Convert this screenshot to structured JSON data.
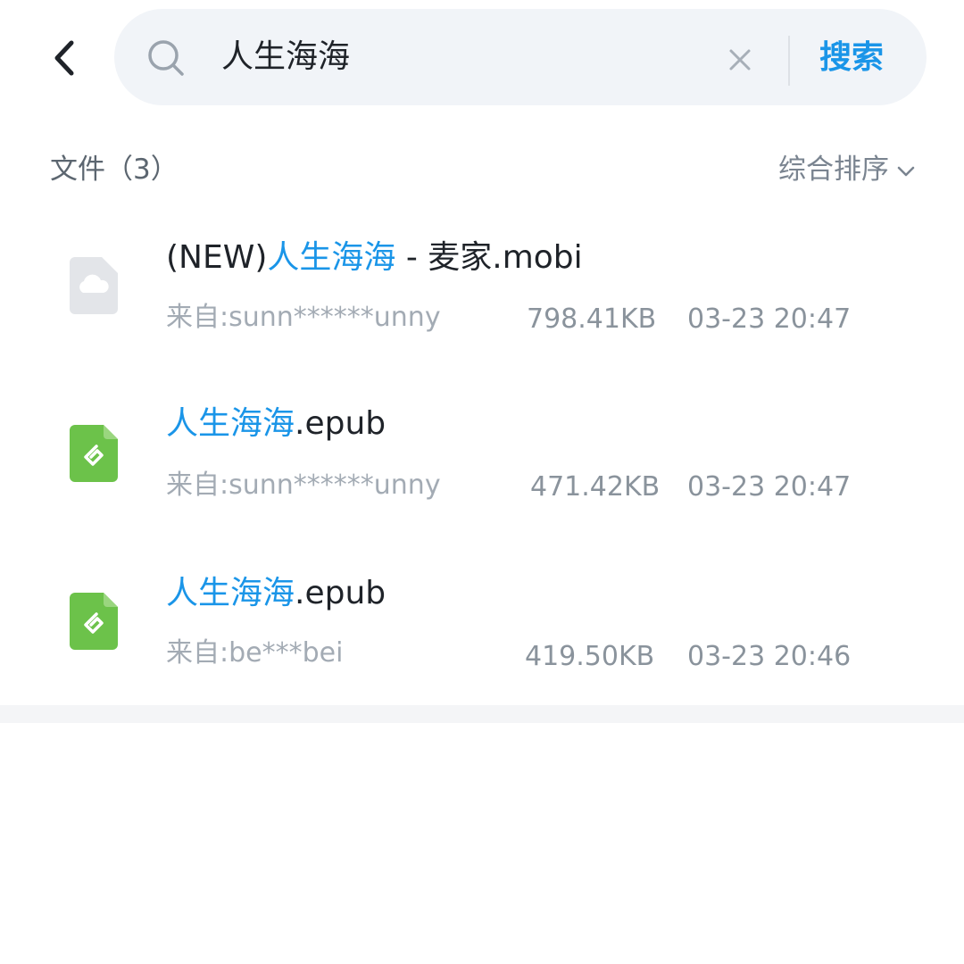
{
  "search": {
    "query": "人生海海",
    "submit_label": "搜索"
  },
  "results": {
    "count_label": "文件（3）",
    "sort_label": "综合排序"
  },
  "files": [
    {
      "name_prefix": "(NEW)",
      "name_highlight": "人生海海",
      "name_suffix": " - 麦家.mobi",
      "type_icon": "cloud-file-icon",
      "source": "来自:sunn******unny",
      "size": "798.41KB",
      "time": "03-23 20:47"
    },
    {
      "name_prefix": "",
      "name_highlight": "人生海海",
      "name_suffix": ".epub",
      "type_icon": "epub-file-icon",
      "source": "来自:sunn******unny",
      "size": "471.42KB",
      "time": "03-23 20:47"
    },
    {
      "name_prefix": "",
      "name_highlight": "人生海海",
      "name_suffix": ".epub",
      "type_icon": "epub-file-icon",
      "source": "来自:be***bei",
      "size": "419.50KB",
      "time": "03-23 20:46"
    }
  ],
  "colors": {
    "accent": "#1a95e8",
    "epub_green": "#6cc24a",
    "cloud_gray": "#e3e5e9"
  }
}
